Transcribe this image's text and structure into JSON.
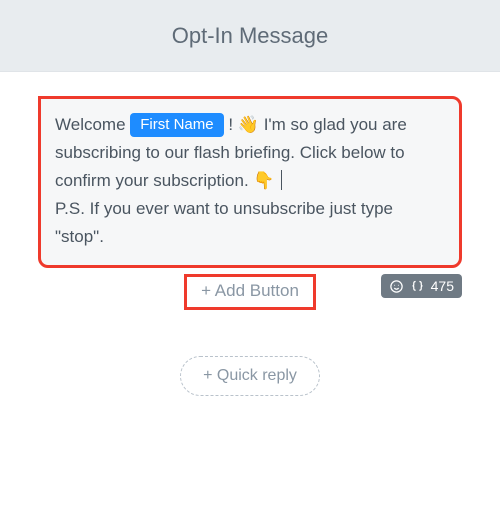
{
  "header": {
    "title": "Opt-In Message"
  },
  "message": {
    "t1": "Welcome ",
    "variable_chip": "First Name",
    "t2": "! ",
    "emoji_wave": "👋",
    "t3": " I'm so glad you are subscribing to our flash briefing. Click below to confirm your subscription. ",
    "emoji_down": "👇",
    "t4": "P.S. If you ever want to unsubscribe just type \"stop\"."
  },
  "actions": {
    "add_button_label": "+ Add Button",
    "quick_reply_label": "+ Quick reply"
  },
  "counter": {
    "chars": "475"
  },
  "icons": {
    "smiley": "smiley-icon",
    "braces": "braces-icon"
  }
}
